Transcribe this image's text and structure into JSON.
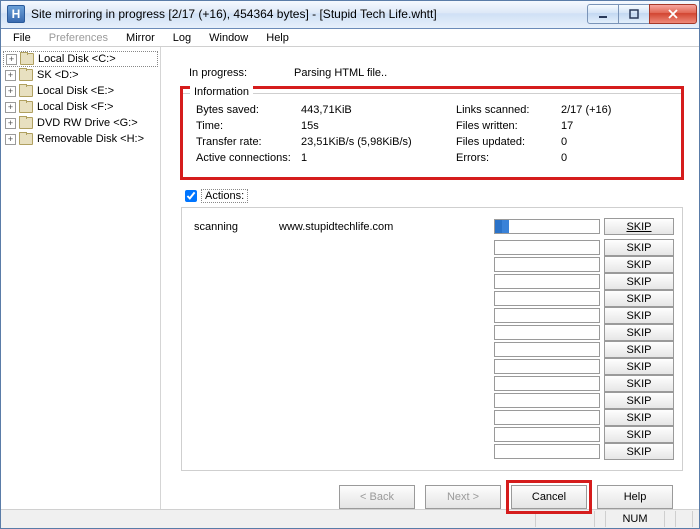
{
  "titlebar": {
    "app_letter": "H",
    "title": "Site mirroring in progress [2/17 (+16), 454364 bytes] - [Stupid Tech Life.whtt]"
  },
  "menubar": [
    "File",
    "Preferences",
    "Mirror",
    "Log",
    "Window",
    "Help"
  ],
  "sidebar": {
    "items": [
      {
        "label": "Local Disk <C:>"
      },
      {
        "label": "SK <D:>"
      },
      {
        "label": "Local Disk <E:>"
      },
      {
        "label": "Local Disk <F:>"
      },
      {
        "label": "DVD RW Drive <G:>"
      },
      {
        "label": "Removable Disk <H:>"
      }
    ]
  },
  "progress": {
    "in_progress_label": "In progress:",
    "in_progress_value": "Parsing HTML file..",
    "info_legend": "Information",
    "bytes_saved_label": "Bytes saved:",
    "bytes_saved_value": "443,71KiB",
    "time_label": "Time:",
    "time_value": "15s",
    "rate_label": "Transfer rate:",
    "rate_value": "23,51KiB/s (5,98KiB/s)",
    "conn_label": "Active connections:",
    "conn_value": "1",
    "links_label": "Links scanned:",
    "links_value": "2/17 (+16)",
    "files_written_label": "Files written:",
    "files_written_value": "17",
    "files_updated_label": "Files updated:",
    "files_updated_value": "0",
    "errors_label": "Errors:",
    "errors_value": "0"
  },
  "actions": {
    "label": "Actions:"
  },
  "transfers": {
    "status": "scanning",
    "url": "www.stupidtechlife.com",
    "skip_label": "SKIP",
    "slot_count": 14
  },
  "buttons": {
    "back": "< Back",
    "next": "Next >",
    "cancel": "Cancel",
    "help": "Help"
  },
  "statusbar": {
    "num": "NUM"
  }
}
